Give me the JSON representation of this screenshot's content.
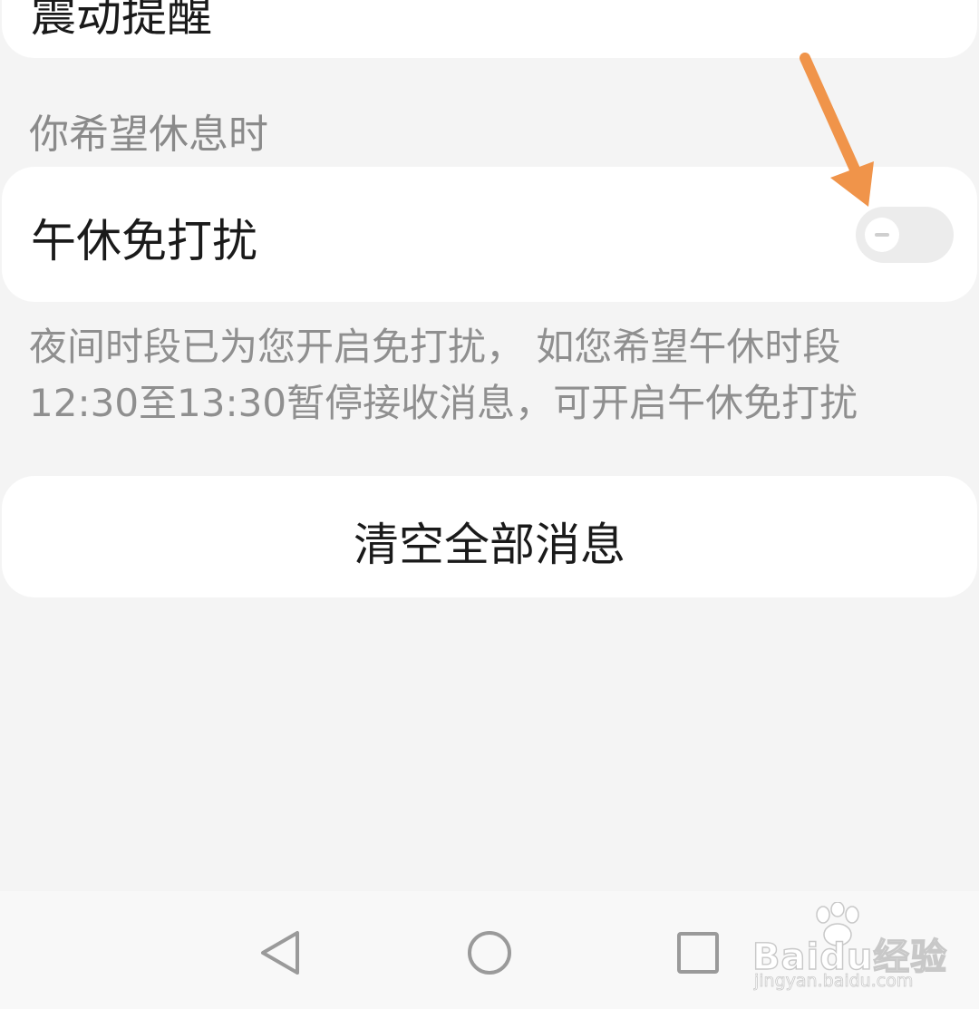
{
  "vibrate": {
    "label": "震动提醒",
    "enabled": true
  },
  "rest_section": {
    "title": "你希望休息时"
  },
  "noon_dnd": {
    "label": "午休免打扰",
    "enabled": false
  },
  "description": {
    "line1": "夜间时段已为您开启免打扰， 如您希望午休时段",
    "line2": "12:30至13:30暂停接收消息，可开启午休免打扰"
  },
  "clear_button": {
    "label": "清空全部消息"
  },
  "navbar": {
    "back_icon": "triangle-back-icon",
    "home_icon": "circle-home-icon",
    "recent_icon": "square-recent-icon"
  },
  "watermark": {
    "brand": "Baidu经验",
    "url": "jingyan.baidu.com"
  },
  "colors": {
    "toggle_on": "#ff5a1f",
    "annotation_arrow": "#f0944a",
    "background": "#f4f4f4"
  }
}
